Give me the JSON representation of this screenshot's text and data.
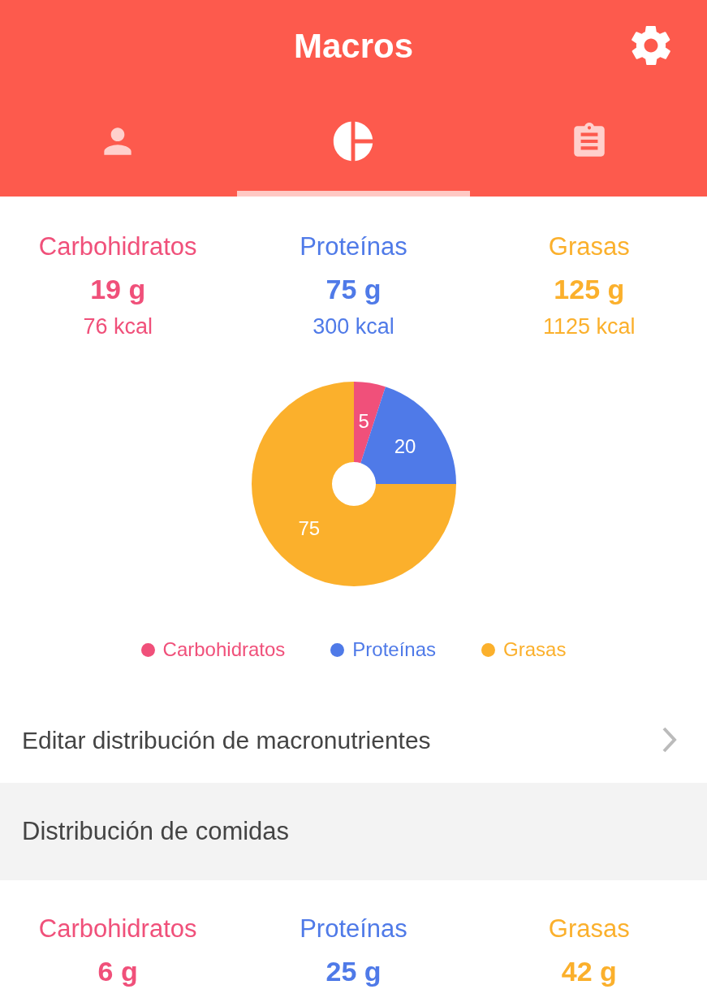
{
  "header": {
    "title": "Macros"
  },
  "tabs": [
    {
      "kind": "person",
      "selected": false
    },
    {
      "kind": "chart",
      "selected": true
    },
    {
      "kind": "clipboard",
      "selected": false
    }
  ],
  "summary": [
    {
      "name": "Carbohidratos",
      "grams": "19 g",
      "kcal": "76 kcal",
      "color": "#f0507a"
    },
    {
      "name": "Proteínas",
      "grams": "75 g",
      "kcal": "300 kcal",
      "color": "#4f7ae8"
    },
    {
      "name": "Grasas",
      "grams": "125 g",
      "kcal": "1125 kcal",
      "color": "#fbb02c"
    }
  ],
  "chart_data": {
    "type": "donut",
    "categories": [
      "Carbohidratos",
      "Proteínas",
      "Grasas"
    ],
    "values": [
      5,
      20,
      75
    ],
    "colors": [
      "#f0507a",
      "#4f7ae8",
      "#fbb02c"
    ],
    "data_labels": true
  },
  "edit_row": {
    "label": "Editar distribución de macronutrientes"
  },
  "section": {
    "title": "Distribución de comidas"
  },
  "meal_summary": [
    {
      "name": "Carbohidratos",
      "grams": "6 g",
      "color": "#f0507a"
    },
    {
      "name": "Proteínas",
      "grams": "25 g",
      "color": "#4f7ae8"
    },
    {
      "name": "Grasas",
      "grams": "42 g",
      "color": "#fbb02c"
    }
  ]
}
